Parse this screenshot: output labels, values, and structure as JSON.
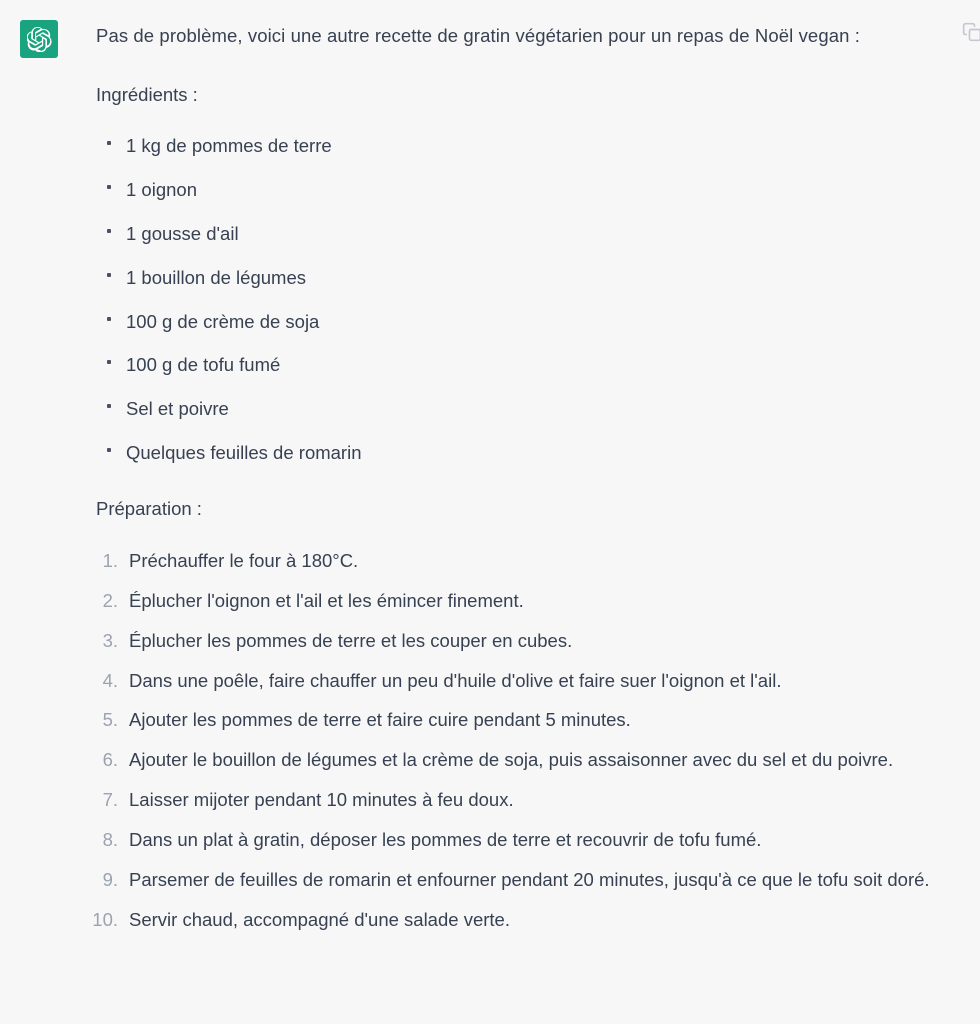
{
  "theme": {
    "background": "#f7f7f8",
    "text_color": "#374151",
    "muted_number_color": "#9ca3af",
    "avatar_background": "#19a37f"
  },
  "message": {
    "author_icon": "openai-logo-icon",
    "intro_paragraph": "Pas de problème, voici une autre recette de gratin végétarien pour un repas de Noël vegan :",
    "ingredients_heading": "Ingrédients :",
    "ingredients": [
      "1 kg de pommes de terre",
      "1 oignon",
      "1 gousse d'ail",
      "1 bouillon de légumes",
      "100 g de crème de soja",
      "100 g de tofu fumé",
      "Sel et poivre",
      "Quelques feuilles de romarin"
    ],
    "preparation_heading": "Préparation :",
    "steps": [
      {
        "number": "1.",
        "text": "Préchauffer le four à 180°C."
      },
      {
        "number": "2.",
        "text": "Éplucher l'oignon et l'ail et les émincer finement."
      },
      {
        "number": "3.",
        "text": "Éplucher les pommes de terre et les couper en cubes."
      },
      {
        "number": "4.",
        "text": "Dans une poêle, faire chauffer un peu d'huile d'olive et faire suer l'oignon et l'ail."
      },
      {
        "number": "5.",
        "text": "Ajouter les pommes de terre et faire cuire pendant 5 minutes."
      },
      {
        "number": "6.",
        "text": "Ajouter le bouillon de légumes et la crème de soja, puis assaisonner avec du sel et du poivre."
      },
      {
        "number": "7.",
        "text": "Laisser mijoter pendant 10 minutes à feu doux."
      },
      {
        "number": "8.",
        "text": "Dans un plat à gratin, déposer les pommes de terre et recouvrir de tofu fumé."
      },
      {
        "number": "9.",
        "text": "Parsemer de feuilles de romarin et enfourner pendant 20 minutes, jusqu'à ce que le tofu soit doré."
      },
      {
        "number": "10.",
        "text": "Servir chaud, accompagné d'une salade verte."
      }
    ],
    "action_icon": "copy-icon"
  }
}
